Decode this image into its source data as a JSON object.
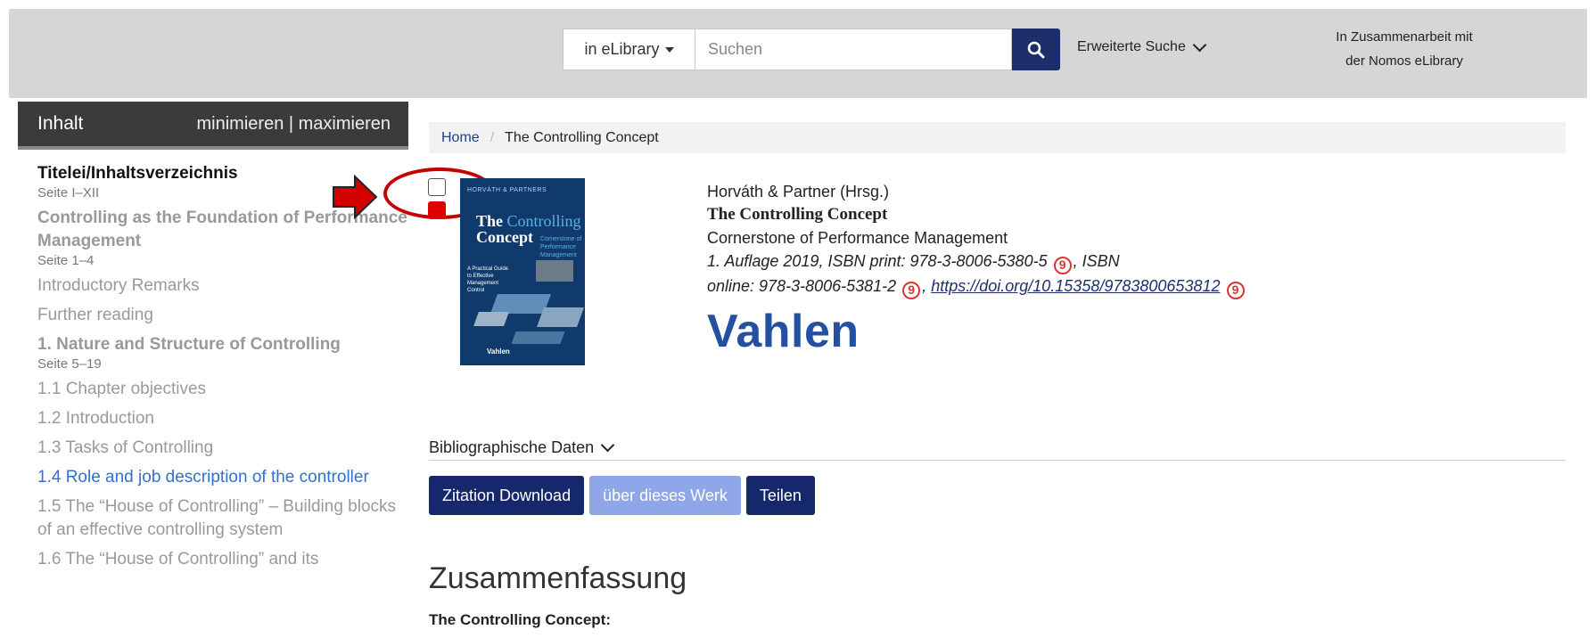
{
  "header": {
    "scope_label": "in eLibrary",
    "search_placeholder": "Suchen",
    "advanced_search_label": "Erweiterte Suche",
    "partner_line1": "In Zusammenarbeit mit",
    "partner_line2": "der Nomos eLibrary"
  },
  "sidebar": {
    "title": "Inhalt",
    "minmax": "minimieren | maximieren",
    "items": [
      {
        "label": "Titelei/Inhaltsverzeichnis",
        "page": "Seite I–XII"
      },
      {
        "label": "Controlling as the Foundation of Performance Management",
        "page": "Seite 1–4"
      },
      {
        "label": "Introductory Remarks"
      },
      {
        "label": "Further reading"
      },
      {
        "label": "1. Nature and Structure of Controlling",
        "page": "Seite 5–19"
      },
      {
        "label": "1.1 Chapter objectives"
      },
      {
        "label": "1.2 Introduction"
      },
      {
        "label": "1.3 Tasks of Controlling"
      },
      {
        "label": "1.4 Role and job description of the controller"
      },
      {
        "label": "1.5 The “House of Controlling” – Building blocks of an effective controlling system"
      },
      {
        "label": "1.6 The “House of Controlling” and its"
      }
    ]
  },
  "breadcrumb": {
    "home": "Home",
    "current": "The Controlling Concept"
  },
  "book": {
    "editor": "Horváth & Partner (Hrsg.)",
    "title": "The Controlling Concept",
    "subtitle": "Cornerstone of Performance Management",
    "edition_line": "1. Auflage 2019, ISBN print: 978-3-8006-5380-5",
    "isbn_label": ", ISBN",
    "online_line": "online: 978-3-8006-5381-2",
    "doi": "https://doi.org/10.15358/9783800653812",
    "publisher": "Vahlen",
    "cover_title_a": "The",
    "cover_title_b": "Controlling",
    "cover_title_c": "Concept",
    "cover_sub": "Cornerstone of Performance Management",
    "cover_note": "A Practical Guide to Effective Management Control",
    "cover_editor": "HORVÁTH & PARTNERS",
    "cover_publisher": "Vahlen"
  },
  "bib_label": "Bibliographische Daten",
  "buttons": {
    "cite": "Zitation Download",
    "about": "über dieses Werk",
    "share": "Teilen"
  },
  "summary": {
    "heading": "Zusammenfassung",
    "subheading": "The Controlling Concept:"
  }
}
